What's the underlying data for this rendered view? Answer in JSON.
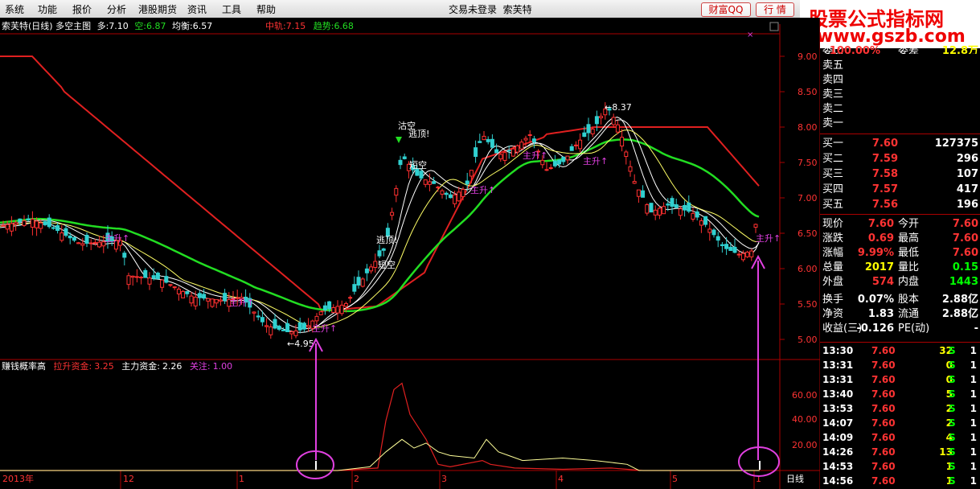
{
  "menu": [
    "系统",
    "功能",
    "报价",
    "分析",
    "港股期货",
    "资讯",
    "工具",
    "帮助"
  ],
  "status_text": "交易未登录",
  "stock_name_title": "索芙特",
  "buttons": {
    "caifu": "财富QQ",
    "hangqing": "行 情"
  },
  "watermark": {
    "line1": "股票公式指标网",
    "line2": "www.gszb.com"
  },
  "main_header": {
    "title": "索芙特(日线) 多空主图",
    "duo_label": "多:",
    "duo_value": "7.10",
    "kong_label": "空:",
    "kong_value": "6.87",
    "junheng_label": "均衡:",
    "junheng_value": "6.57",
    "zhongqu_label": "中轨:",
    "zhongqu_value": "7.15",
    "qushi_label": "趋势:",
    "qushi_value": "6.68"
  },
  "sub_header": {
    "title": "赚钱概率高",
    "lasheng_label": "拉升资金:",
    "lasheng_value": "3.25",
    "zhuli_label": "主力资金:",
    "zhuli_value": "2.26",
    "guanzhu_label": "关注:",
    "guanzhu_value": "1.00"
  },
  "price_axis": [
    "9.00",
    "8.50",
    "8.00",
    "7.50",
    "7.00",
    "6.50",
    "6.00",
    "5.50",
    "5.00"
  ],
  "sub_axis": [
    "60.00",
    "40.00",
    "20.00"
  ],
  "date_axis": [
    "2013年",
    "12",
    "1",
    "2",
    "3",
    "4",
    "5",
    "1"
  ],
  "period_label": "日线",
  "annotations": {
    "low": "4.95",
    "high": "8.37",
    "zhusheng": "主升↑",
    "taoding": "逃顶!",
    "gukong": "沽空",
    "duankong": "短空"
  },
  "colors": {
    "red": "#e02020",
    "green": "#22dd22",
    "up": "#ff3030",
    "down": "#30d0d0",
    "magenta": "#e040e0"
  },
  "order_book": {
    "partial_row": {
      "label1": "委比",
      "value1": "100.00%",
      "label2": "委差",
      "value2": "12.8万"
    },
    "sells": [
      {
        "name": "卖五"
      },
      {
        "name": "卖四"
      },
      {
        "name": "卖三"
      },
      {
        "name": "卖二"
      },
      {
        "name": "卖一"
      }
    ],
    "buys": [
      {
        "name": "买一",
        "price": "7.60",
        "vol": "127375"
      },
      {
        "name": "买二",
        "price": "7.59",
        "vol": "296"
      },
      {
        "name": "买三",
        "price": "7.58",
        "vol": "107"
      },
      {
        "name": "买四",
        "price": "7.57",
        "vol": "417"
      },
      {
        "name": "买五",
        "price": "7.56",
        "vol": "196"
      }
    ]
  },
  "quote": [
    {
      "n1": "现价",
      "v1": "7.60",
      "c1": "#f33",
      "n2": "今开",
      "v2": "7.60",
      "c2": "#f33"
    },
    {
      "n1": "涨跌",
      "v1": "0.69",
      "c1": "#f33",
      "n2": "最高",
      "v2": "7.60",
      "c2": "#f33"
    },
    {
      "n1": "涨幅",
      "v1": "9.99%",
      "c1": "#f33",
      "n2": "最低",
      "v2": "7.60",
      "c2": "#f33"
    },
    {
      "n1": "总量",
      "v1": "2017",
      "c1": "#ff0",
      "n2": "量比",
      "v2": "0.15",
      "c2": "#0f0"
    },
    {
      "n1": "外盘",
      "v1": "574",
      "c1": "#f33",
      "n2": "内盘",
      "v2": "1443",
      "c2": "#0f0"
    },
    {
      "n1": "换手",
      "v1": "0.07%",
      "c1": "#fff",
      "n2": "股本",
      "v2": "2.88亿",
      "c2": "#fff"
    },
    {
      "n1": "净资",
      "v1": "1.83",
      "c1": "#fff",
      "n2": "流通",
      "v2": "2.88亿",
      "c2": "#fff"
    },
    {
      "n1": "收益(三)",
      "v1": "-0.126",
      "c1": "#fff",
      "n2": "PE(动)",
      "v2": "-",
      "c2": "#fff"
    }
  ],
  "ticks": [
    {
      "time": "13:30",
      "price": "7.60",
      "vol": "32",
      "bs": "S",
      "n": "1"
    },
    {
      "time": "13:31",
      "price": "7.60",
      "vol": "0",
      "bs": "S",
      "n": "1"
    },
    {
      "time": "13:31",
      "price": "7.60",
      "vol": "0",
      "bs": "S",
      "n": "1"
    },
    {
      "time": "13:40",
      "price": "7.60",
      "vol": "5",
      "bs": "S",
      "n": "1"
    },
    {
      "time": "13:53",
      "price": "7.60",
      "vol": "2",
      "bs": "S",
      "n": "1"
    },
    {
      "time": "14:07",
      "price": "7.60",
      "vol": "2",
      "bs": "S",
      "n": "1"
    },
    {
      "time": "14:09",
      "price": "7.60",
      "vol": "4",
      "bs": "S",
      "n": "1"
    },
    {
      "time": "14:26",
      "price": "7.60",
      "vol": "13",
      "bs": "S",
      "n": "1"
    },
    {
      "time": "14:53",
      "price": "7.60",
      "vol": "1",
      "bs": "S",
      "n": "1"
    },
    {
      "time": "14:56",
      "price": "7.60",
      "vol": "1",
      "bs": "S",
      "n": "1"
    }
  ]
}
